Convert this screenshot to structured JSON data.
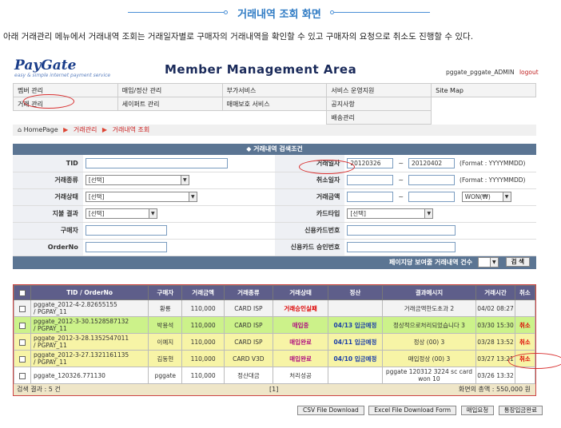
{
  "doc": {
    "title": "거래내역 조회 화면",
    "description": "아래 거래관리 메뉴에서 거래내역 조회는 거래일자별로 구매자의 거래내역을 확인할 수 있고  구매자의 요청으로 취소도 진행할 수 있다."
  },
  "header": {
    "logo_name": "PayGate",
    "logo_tag": "easy & simple internet payment service",
    "title": "Member Management Area",
    "user": "pggate_pggate_ADMIN",
    "logout": "logout"
  },
  "menu": {
    "row1": [
      "멤버 관리",
      "매입/정산 관리",
      "부가서비스",
      "서비스 운영지원",
      "Site Map"
    ],
    "row2": [
      "거래 관리",
      "세이퍼트 관리",
      "매매보호 서비스",
      "공지사항"
    ],
    "row3": [
      "배송관리"
    ]
  },
  "breadcrumb": {
    "home": "HomePage",
    "level1": "거래관리",
    "level2": "거래내역 조회"
  },
  "search": {
    "header": "◆ 거래내역 검색조건",
    "tid_label": "TID",
    "tran_date_label": "거래일자",
    "date_from": "20120326",
    "date_to": "20120402",
    "format_hint": "(Format : YYYYMMDD)",
    "tran_type_label": "거래종류",
    "tran_type_value": "[선택]",
    "cancel_date_label": "취소일자",
    "tran_status_label": "거래상태",
    "tran_status_value": "[선택]",
    "amount_label": "거래금액",
    "currency_value": "WON(₩)",
    "pay_result_label": "지불 결과",
    "pay_result_value": "[선택]",
    "card_type_label": "카드타입",
    "card_type_value": "[선택]",
    "buyer_label": "구매자",
    "card_no_label": "신용카드번호",
    "order_no_label": "OrderNo",
    "approval_no_label": "신용카드 승인번호",
    "per_page_label": "페이지당 보여줄 거래내역 건수",
    "per_page_value": "10",
    "search_button": "검 색"
  },
  "results": {
    "columns": [
      "TID / OrderNo",
      "구매자",
      "거래금액",
      "거래종류",
      "거래상태",
      "정산",
      "결과메시지",
      "거래시간",
      "취소"
    ],
    "rows": [
      {
        "tid": "pggate_2012-4-2.82655155",
        "order": "/ PGPAY_11",
        "buyer": "황룡",
        "amount": "110,000",
        "type": "CARD ISP",
        "status": "거래승인실패",
        "settle": "",
        "message": "거래금액한도초과 2",
        "time": "04/02 08:27",
        "cancel": ""
      },
      {
        "tid": "pggate_2012-3-30.1528587132",
        "order": "/ PGPAY_11",
        "buyer": "박용석",
        "amount": "110,000",
        "type": "CARD ISP",
        "status": "매입중",
        "settle": "04/13 입금예정",
        "message": "정상적으로처리되었습니다 3",
        "time": "03/30 15:30",
        "cancel": "취소"
      },
      {
        "tid": "pggate_2012-3-28.1352547011",
        "order": "/ PGPAY_11",
        "buyer": "이예지",
        "amount": "110,000",
        "type": "CARD ISP",
        "status": "매입완료",
        "settle": "04/11 입금예정",
        "message": "정상 (00) 3",
        "time": "03/28 13:52",
        "cancel": "취소"
      },
      {
        "tid": "pggate_2012-3-27.1321161135",
        "order": "/ PGPAY_11",
        "buyer": "김동현",
        "amount": "110,000",
        "type": "CARD V3D",
        "status": "매입완료",
        "settle": "04/10 입금예정",
        "message": "매입정상 (00) 3",
        "time": "03/27 13:21",
        "cancel": "취소"
      },
      {
        "tid": "pggate_120326.771130",
        "order": "",
        "buyer": "pggate",
        "amount": "110,000",
        "type": "정산대금",
        "status": "처리성공",
        "settle": "",
        "message": "pggate 120312 3224 sc card won 10",
        "time": "03/26 13:32",
        "cancel": ""
      }
    ],
    "footer_count": "검색 결과 : 5 건",
    "footer_page": "[1]",
    "footer_total_label": "화면의 총액",
    "footer_total": ": 550,000 원"
  },
  "buttons": {
    "csv": "CSV File Download",
    "excel": "Excel File Download Form",
    "purchase": "매입요청",
    "bank": "통장입금완료"
  }
}
